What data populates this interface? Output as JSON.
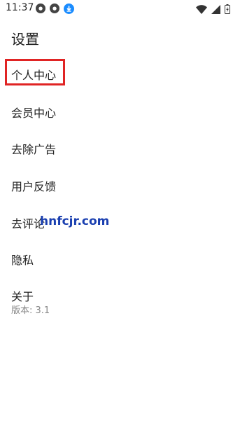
{
  "status_bar": {
    "time": "11:37",
    "notif_icon_1": "circle-notification-icon",
    "notif_icon_2": "circle-notification-icon",
    "download_icon": "download-icon",
    "wifi_icon": "wifi-icon",
    "signal_icon": "signal-icon",
    "battery_icon": "battery-charging-icon"
  },
  "page": {
    "title": "设置"
  },
  "menu": {
    "personal_center": "个人中心",
    "member_center": "会员中心",
    "remove_ads": "去除广告",
    "user_feedback": "用户反馈",
    "rate": "去评论",
    "privacy": "隐私",
    "about": "关于",
    "version": "版本: 3.1"
  },
  "watermark": {
    "text": "hnfcjr.com"
  },
  "colors": {
    "highlight": "#e02424",
    "watermark": "#1a3fb0",
    "download": "#1a8cff"
  }
}
